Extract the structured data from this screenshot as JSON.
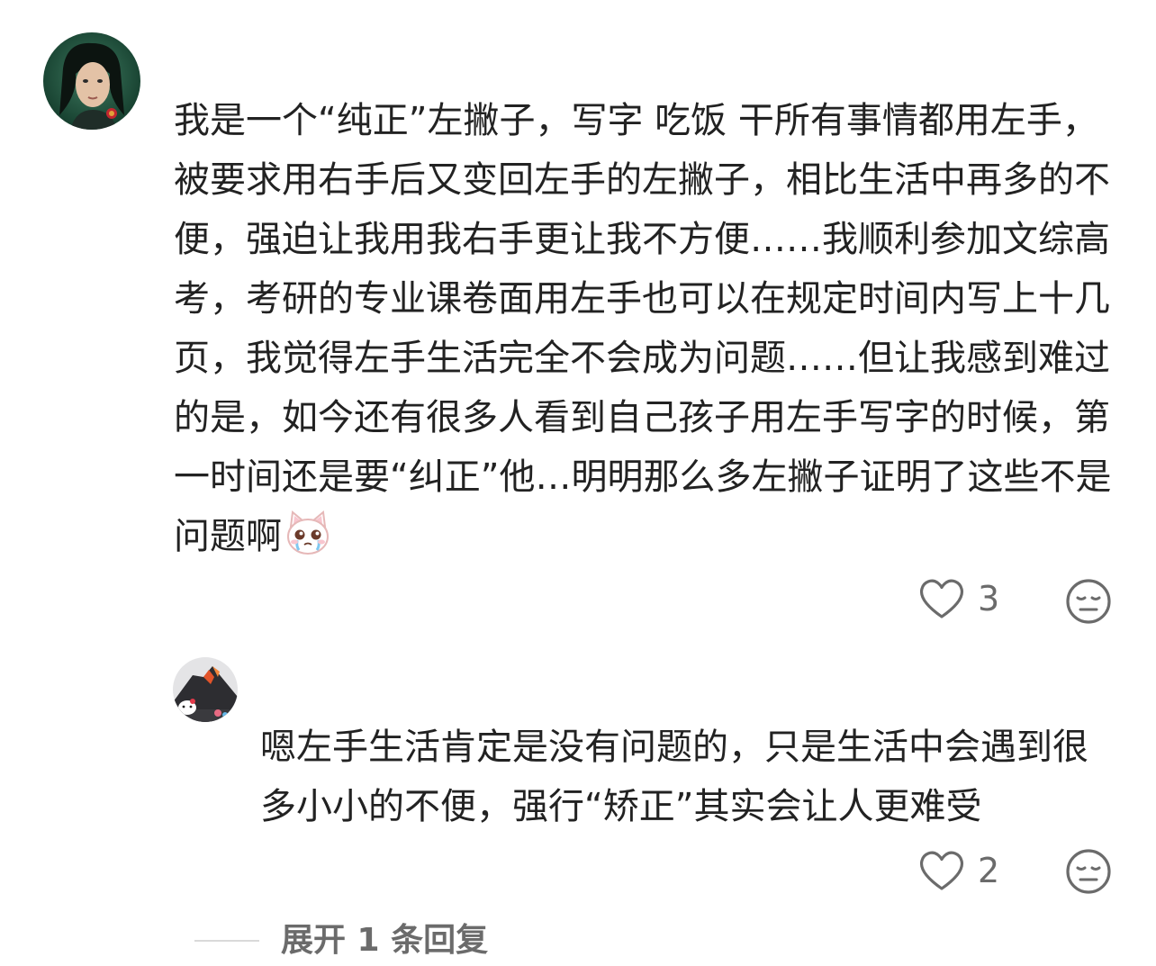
{
  "comments": [
    {
      "text": "我是一个“纯正”左撇子，写字 吃饭 干所有事情都用左手，被要求用右手后又变回左手的左撇子，相比生活中再多的不便，强迫让我用我右手更让我不方便……我顺利参加文综高考，考研的专业课卷面用左手也可以在规定时间内写上十几页，我觉得左手生活完全不会成为问题……但让我感到难过的是，如今还有很多人看到自己孩子用左手写字的时候，第一时间还是要“纠正”他…明明那么多左撇子证明了这些不是问题啊",
      "emoji": "crying-cat-emoji",
      "likes": "3"
    },
    {
      "text": "嗯左手生活肯定是没有问题的，只是生活中会遇到很多小小的不便，强行“矫正”其实会让人更难受",
      "likes": "2"
    }
  ],
  "expand_replies_label": "展开 1 条回复",
  "icons": {
    "like": "heart-outline-icon",
    "dislike": "neutral-face-icon"
  },
  "colors": {
    "text": "#222222",
    "muted": "#6b6b6b",
    "divider": "#d9d9d9",
    "background": "#ffffff"
  }
}
